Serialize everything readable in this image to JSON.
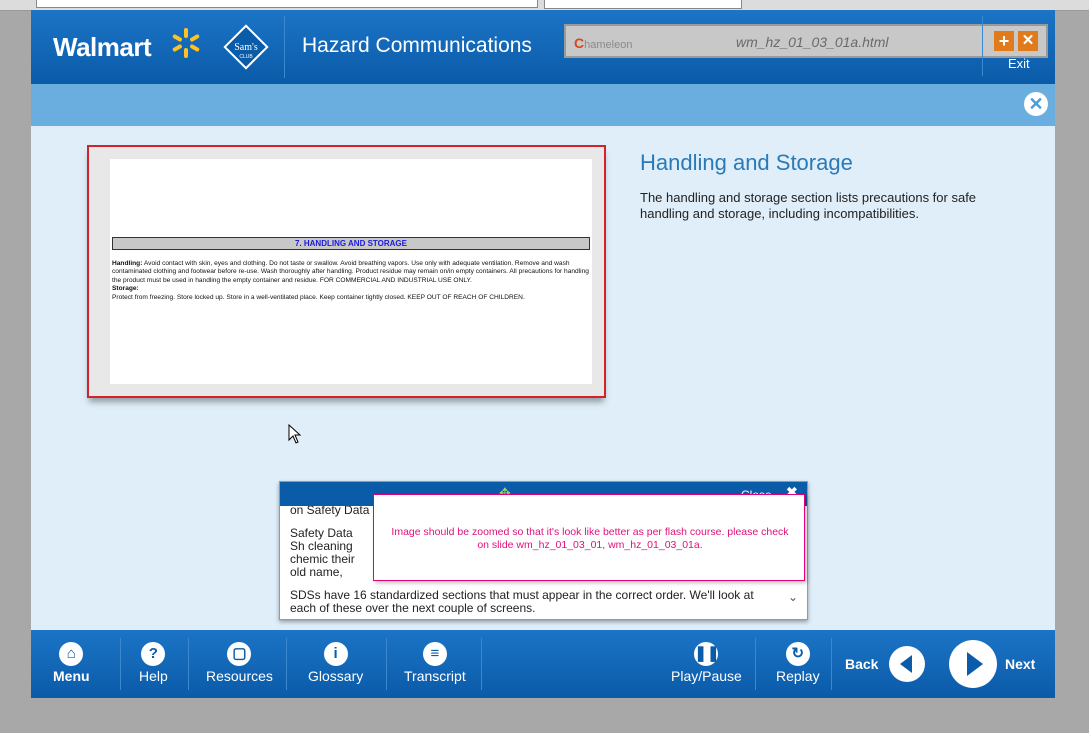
{
  "header": {
    "brand": "Walmart",
    "sams_label": "Sam's",
    "sams_sub": "CLUB",
    "course_title": "Hazard Communications",
    "exit_label": "Exit"
  },
  "chameleon": {
    "logo_text": "hameleon",
    "logo_letter": "C",
    "filename": "wm_hz_01_03_01a.html",
    "plus_label": "+",
    "close_label": "✕"
  },
  "subbar": {
    "close_label": "✕"
  },
  "sds": {
    "section_heading": "7. HANDLING AND STORAGE",
    "handling_label": "Handling:",
    "handling_text": "Avoid contact with skin, eyes and clothing.  Do not taste or swallow.  Avoid breathing vapors.  Use only with adequate ventilation. Remove and wash contaminated clothing and footwear before re-use.  Wash thoroughly after handling.  Product residue may remain on/in empty containers.  All precautions for handling the product must be used in handling the empty container and residue. FOR COMMERCIAL AND INDUSTRIAL USE ONLY.",
    "storage_label": "Storage:",
    "storage_text": "Protect from freezing.  Store locked up.  Store in a well-ventilated place. Keep container tightly closed.   KEEP OUT OF REACH OF CHILDREN."
  },
  "slide": {
    "title": "Handling and Storage",
    "text": "The handling and storage section lists precautions for safe handling and storage, including incompatibilities."
  },
  "transcript": {
    "close_label": "Close",
    "line_top": "on Safety Data",
    "para1": "Safety Data Sh cleaning chemic their old name,",
    "para2": "SDSs have 16 standardized sections that must appear in the correct order.  We'll look at each of these over the next couple of screens."
  },
  "review_note": {
    "text": "Image should be zoomed so that it's look like better as per flash course. please check on slide wm_hz_01_03_01, wm_hz_01_03_01a."
  },
  "nav": {
    "items": [
      {
        "label": "Menu",
        "icon": "home-icon"
      },
      {
        "label": "Help",
        "icon": "question-icon"
      },
      {
        "label": "Resources",
        "icon": "document-icon"
      },
      {
        "label": "Glossary",
        "icon": "info-icon"
      },
      {
        "label": "Transcript",
        "icon": "list-icon"
      },
      {
        "label": "Play/Pause",
        "icon": "pause-icon"
      },
      {
        "label": "Replay",
        "icon": "replay-icon"
      }
    ],
    "back_label": "Back",
    "next_label": "Next"
  },
  "colors": {
    "header_blue": "#0a5ba8",
    "subbar_blue": "#6aaee0",
    "content_bg": "#dfeef8",
    "title_blue": "#2a7ab8",
    "frame_red": "#d2232a",
    "note_pink": "#e0107a",
    "spark_yellow": "#ffc220"
  }
}
